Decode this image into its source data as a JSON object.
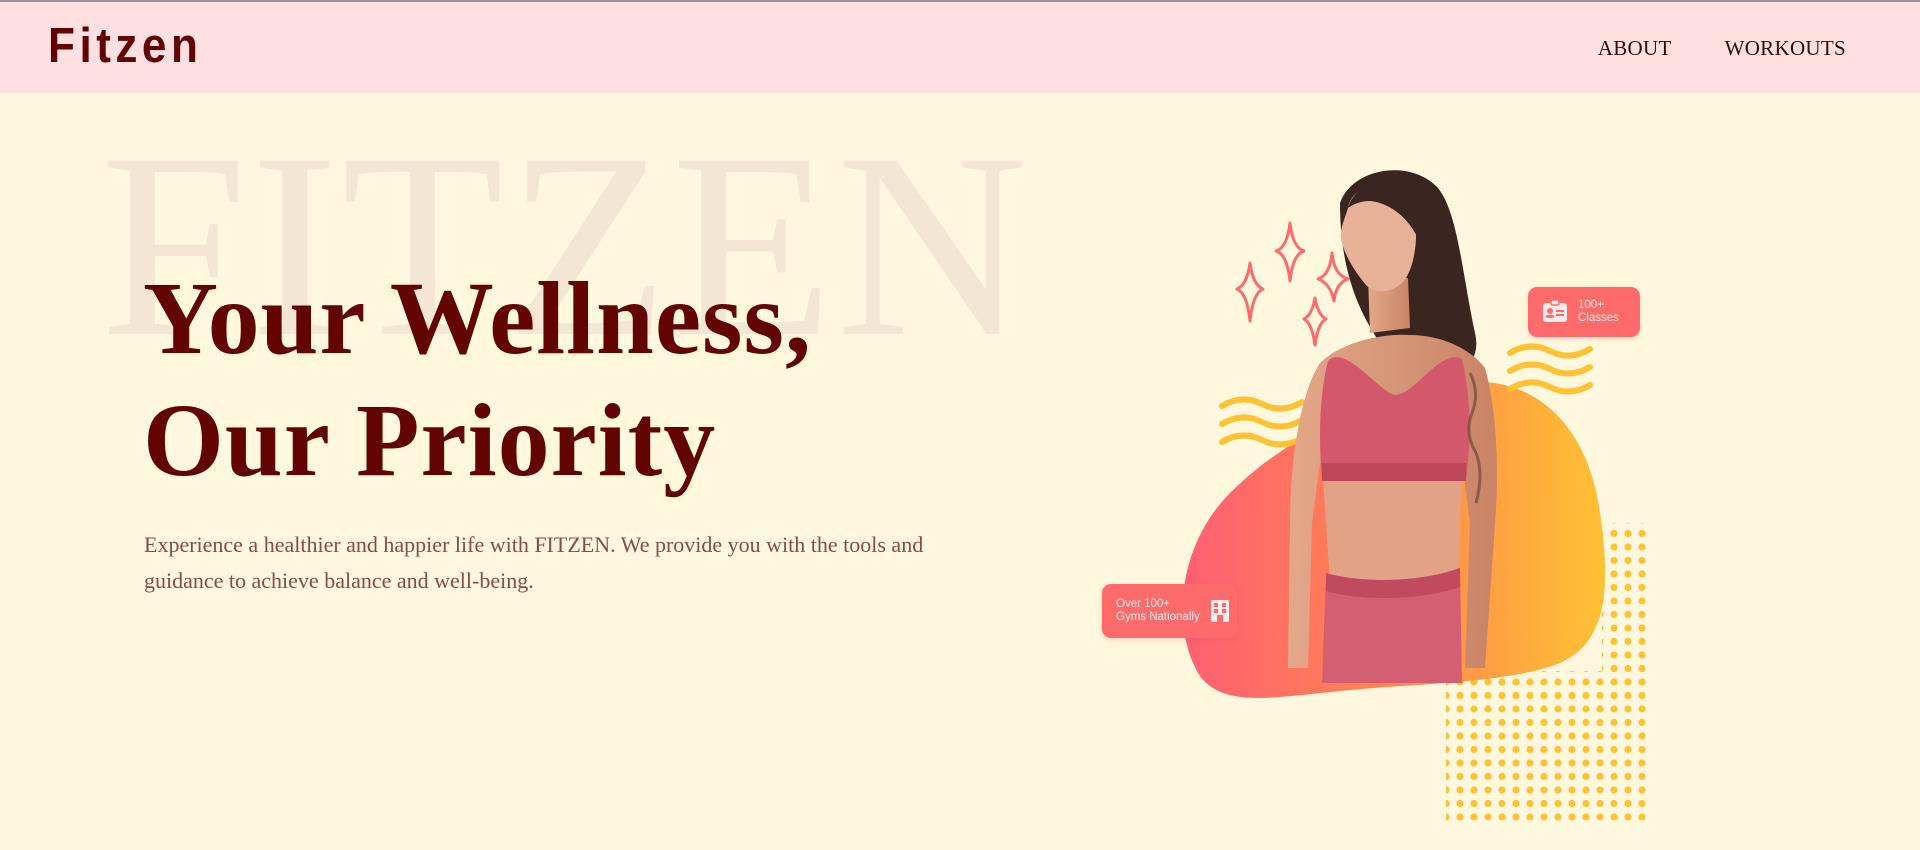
{
  "header": {
    "logo": "Fitzen",
    "nav": [
      {
        "label": "ABOUT"
      },
      {
        "label": "WORKOUTS"
      }
    ]
  },
  "hero": {
    "watermark": "FITZEN",
    "headline_line1": "Your Wellness,",
    "headline_line2": "Our Priority",
    "subtext": "Experience a healthier and happier life with FITZEN. We provide you with the tools and guidance to achieve balance and well-being."
  },
  "badges": {
    "classes": {
      "line1": "100+",
      "line2": "Classes",
      "icon": "id-card-icon"
    },
    "gyms": {
      "line1": "Over 100+",
      "line2": "Gyms Nationally",
      "icon": "building-icon"
    }
  },
  "colors": {
    "page_bg": "#fff8de",
    "navbar_bg": "#ffe0e0",
    "brand_dark_red": "#630404",
    "body_text": "#8a4a48",
    "badge_coral": "#ff6b6b",
    "accent_yellow": "#ffc234",
    "accent_orange": "#ff8a4c"
  }
}
